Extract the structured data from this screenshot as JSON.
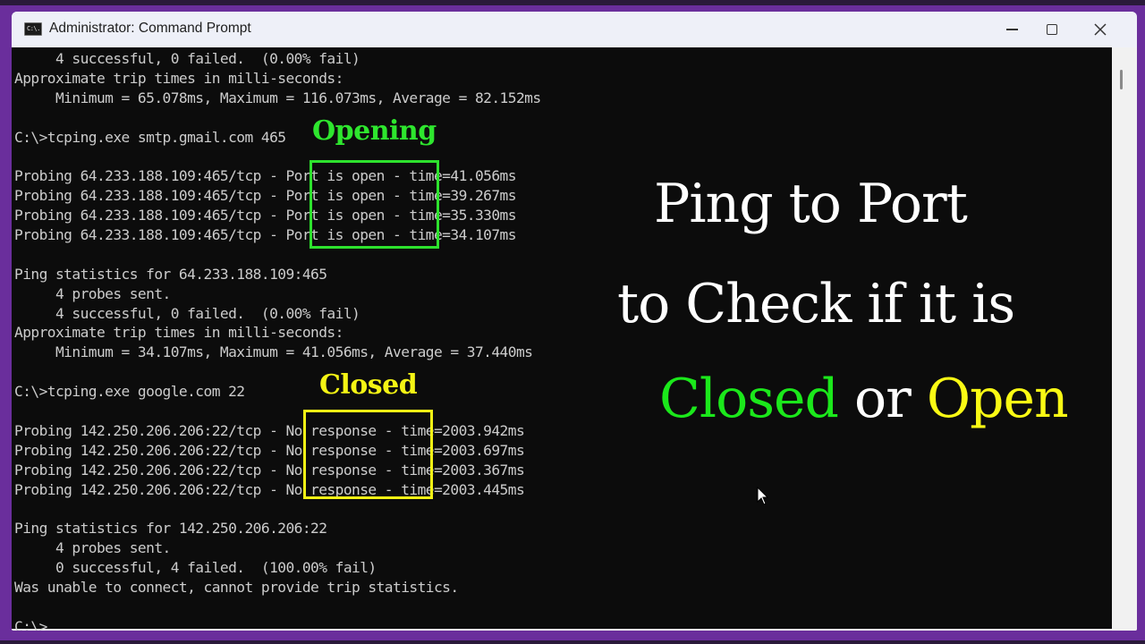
{
  "window": {
    "title": "Administrator: Command Prompt",
    "app_icon_text": "C:\\.",
    "controls": {
      "minimize": "minimize",
      "maximize": "maximize",
      "close": "close"
    }
  },
  "terminal": {
    "lines": [
      "     4 successful, 0 failed.  (0.00% fail)",
      "Approximate trip times in milli-seconds:",
      "     Minimum = 65.078ms, Maximum = 116.073ms, Average = 82.152ms",
      "",
      "C:\\>tcping.exe smtp.gmail.com 465",
      "",
      "Probing 64.233.188.109:465/tcp - Port is open - time=41.056ms",
      "Probing 64.233.188.109:465/tcp - Port is open - time=39.267ms",
      "Probing 64.233.188.109:465/tcp - Port is open - time=35.330ms",
      "Probing 64.233.188.109:465/tcp - Port is open - time=34.107ms",
      "",
      "Ping statistics for 64.233.188.109:465",
      "     4 probes sent.",
      "     4 successful, 0 failed.  (0.00% fail)",
      "Approximate trip times in milli-seconds:",
      "     Minimum = 34.107ms, Maximum = 41.056ms, Average = 37.440ms",
      "",
      "C:\\>tcping.exe google.com 22",
      "",
      "Probing 142.250.206.206:22/tcp - No response - time=2003.942ms",
      "Probing 142.250.206.206:22/tcp - No response - time=2003.697ms",
      "Probing 142.250.206.206:22/tcp - No response - time=2003.367ms",
      "Probing 142.250.206.206:22/tcp - No response - time=2003.445ms",
      "",
      "Ping statistics for 142.250.206.206:22",
      "     4 probes sent.",
      "     0 successful, 4 failed.  (100.00% fail)",
      "Was unable to connect, cannot provide trip statistics.",
      "",
      "C:\\>"
    ]
  },
  "annotations": {
    "opening_label": "Opening",
    "closed_label": "Closed",
    "opening_color": "#2ee62e",
    "closed_color": "#f4f414"
  },
  "headline": {
    "line1": "Ping to Port",
    "line2": "to Check if it is",
    "word_closed": "Closed",
    "word_or": " or ",
    "word_open": "Open",
    "closed_color": "#1be81b",
    "open_color": "#fafa14"
  },
  "colors": {
    "frame": "#6a2e9c",
    "terminal_bg": "#0c0c0c",
    "terminal_fg": "#cccccc"
  }
}
